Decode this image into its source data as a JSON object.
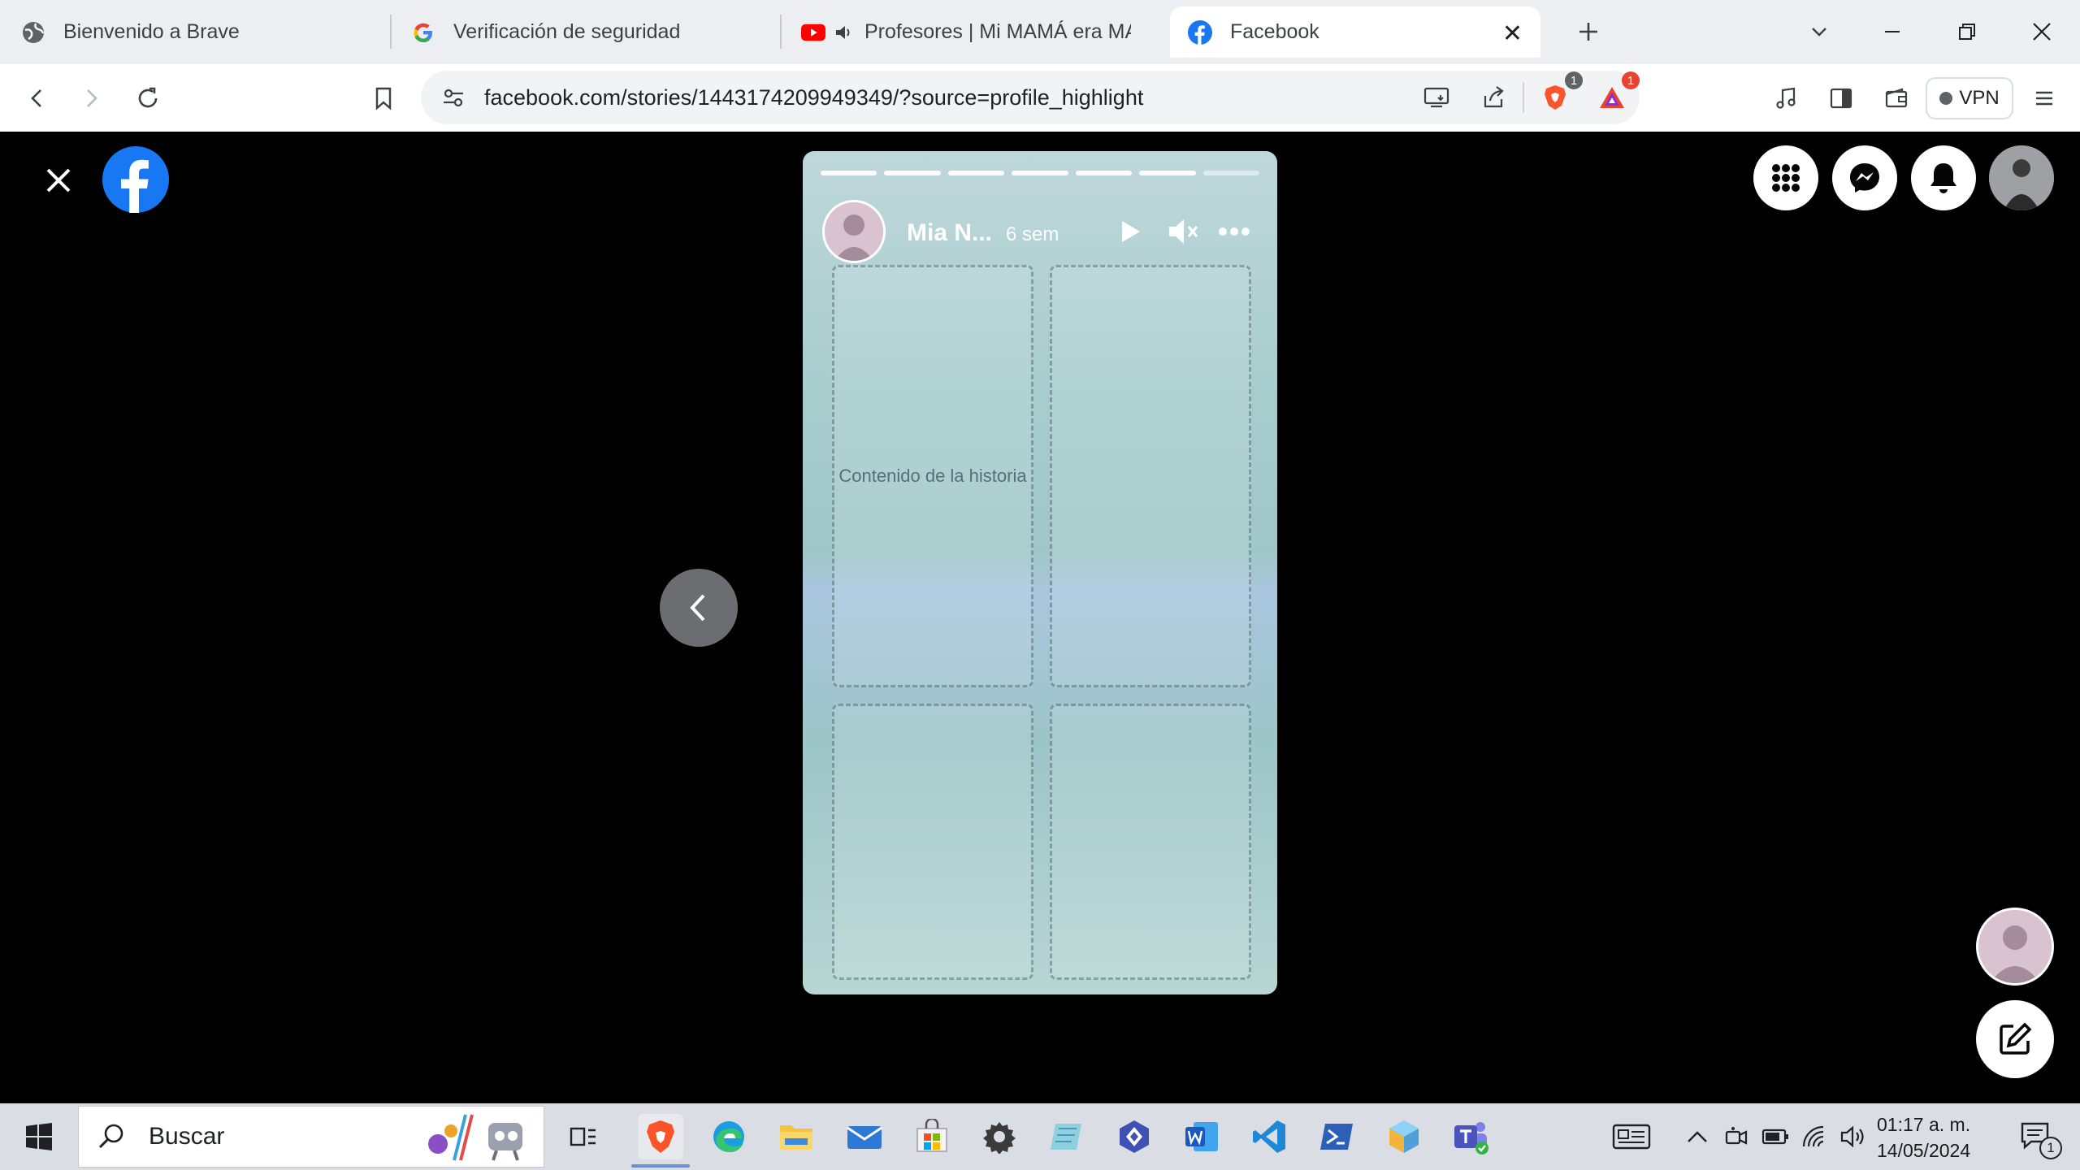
{
  "browser": {
    "tabs": [
      {
        "title": "Bienvenido a Brave",
        "icon": "globe-icon"
      },
      {
        "title": "Verificación de seguridad",
        "icon": "google-icon"
      },
      {
        "title": "Profesores | Mi MAMÁ era MAES",
        "icon": "youtube-icon",
        "audio": true
      },
      {
        "title": "Facebook",
        "icon": "facebook-icon",
        "active": true
      }
    ],
    "url": "facebook.com/stories/1443174209949349/?source=profile_highlight",
    "shields_badge": "1",
    "rewards_badge": "1",
    "vpn_label": "VPN"
  },
  "story": {
    "author": "Mia N...",
    "time": "6 sem",
    "progress": {
      "total": 7,
      "completed": 6
    },
    "image_placeholder": "Contenido de la historia"
  },
  "taskbar": {
    "search_label": "Buscar",
    "time": "01:17 a. m.",
    "date": "14/05/2024",
    "notification_count": "1"
  },
  "colors": {
    "facebook_blue": "#1877f2",
    "brave_orange": "#fb542b",
    "youtube_red": "#ff0000"
  }
}
